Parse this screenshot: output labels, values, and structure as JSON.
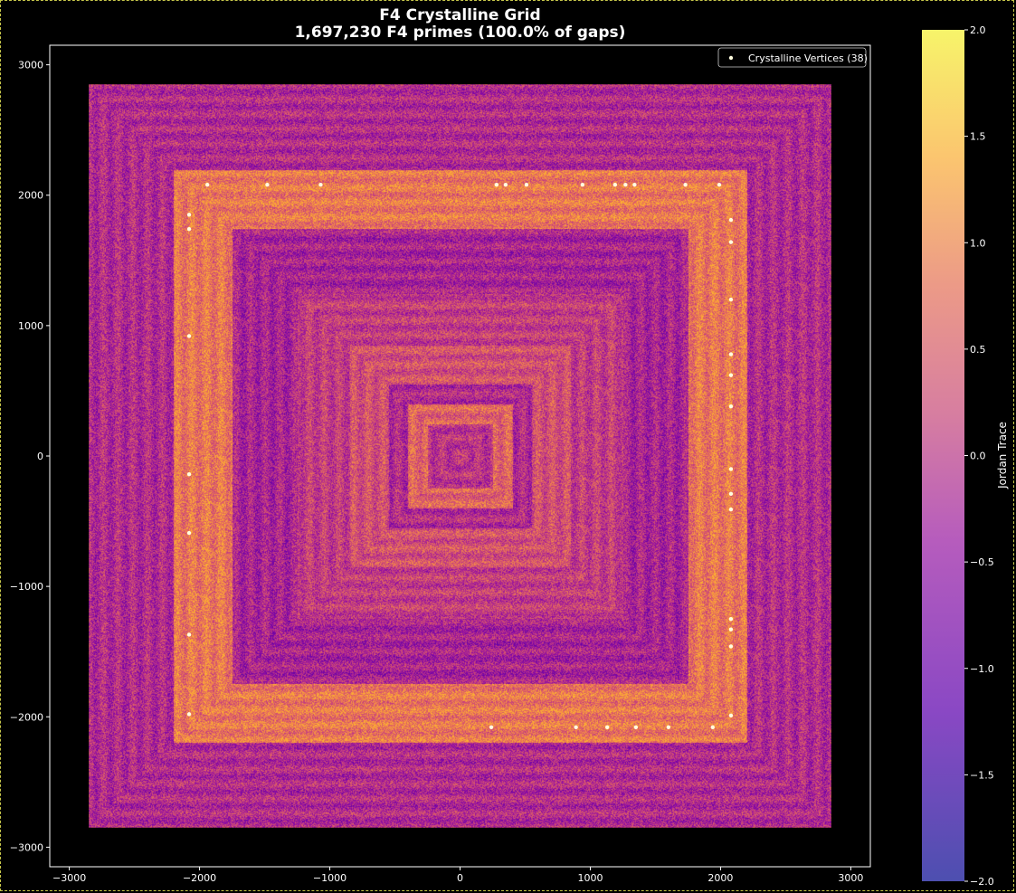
{
  "chart_data": {
    "type": "scatter",
    "title": "F4 Crystalline Grid",
    "subtitle": "1,697,230 F4 primes (100.0% of gaps)",
    "xlabel": "",
    "ylabel": "",
    "xlim": [
      -3150,
      3150
    ],
    "ylim": [
      -3150,
      3150
    ],
    "x_ticks": [
      -3000,
      -2000,
      -1000,
      0,
      1000,
      2000,
      3000
    ],
    "x_tick_labels": [
      "−3000",
      "−2000",
      "−1000",
      "0",
      "1000",
      "2000",
      "3000"
    ],
    "y_ticks": [
      -3000,
      -2000,
      -1000,
      0,
      1000,
      2000,
      3000
    ],
    "y_tick_labels": [
      "−3000",
      "−2000",
      "−1000",
      "0",
      "1000",
      "2000",
      "3000"
    ],
    "grid": false,
    "background": "#000000",
    "colormap": "plasma",
    "colorbar": {
      "label": "Jordan Trace",
      "range": [
        -2.0,
        2.0
      ],
      "ticks": [
        2.0,
        1.5,
        1.0,
        0.5,
        0.0,
        -0.5,
        -1.0,
        -1.5,
        -2.0
      ],
      "tick_labels": [
        "2.0",
        "1.5",
        "1.0",
        "0.5",
        "0.0",
        "−0.5",
        "−1.0",
        "−1.5",
        "−2.0"
      ]
    },
    "density_field": {
      "extent": [
        -2850,
        2850
      ],
      "description_rings": [
        {
          "half_size": 2850,
          "level": 0.35
        },
        {
          "half_size": 2200,
          "level": 0.75
        },
        {
          "half_size": 1750,
          "level": 0.3
        },
        {
          "half_size": 1250,
          "level": 0.45
        },
        {
          "half_size": 850,
          "level": 0.55
        },
        {
          "half_size": 550,
          "level": 0.35
        },
        {
          "half_size": 400,
          "level": 0.65
        },
        {
          "half_size": 250,
          "level": 0.4
        }
      ]
    },
    "series": [
      {
        "name": "Crystalline Vertices (38)",
        "color": "#fffde0",
        "x": [
          -1940,
          -1480,
          -1070,
          280,
          350,
          510,
          940,
          1190,
          1270,
          1340,
          1730,
          1990,
          -2080,
          -2080,
          -2080,
          -2080,
          -2080,
          -2080,
          -2080,
          2080,
          2080,
          2080,
          2080,
          2080,
          2080,
          2080,
          2080,
          2080,
          2080,
          2080,
          2080,
          2080,
          240,
          890,
          1130,
          1350,
          1600,
          1940
        ],
        "y": [
          2080,
          2080,
          2080,
          2080,
          2080,
          2080,
          2080,
          2080,
          2080,
          2080,
          2080,
          2080,
          1850,
          1740,
          920,
          -140,
          -590,
          -1370,
          -1980,
          1810,
          1640,
          1200,
          780,
          620,
          380,
          -100,
          -290,
          -410,
          -1250,
          -1330,
          -1460,
          -1990,
          -2080,
          -2080,
          -2080,
          -2080,
          -2080,
          -2080
        ]
      }
    ],
    "legend": {
      "position": "top-right",
      "label": "Crystalline Vertices (38)"
    }
  }
}
